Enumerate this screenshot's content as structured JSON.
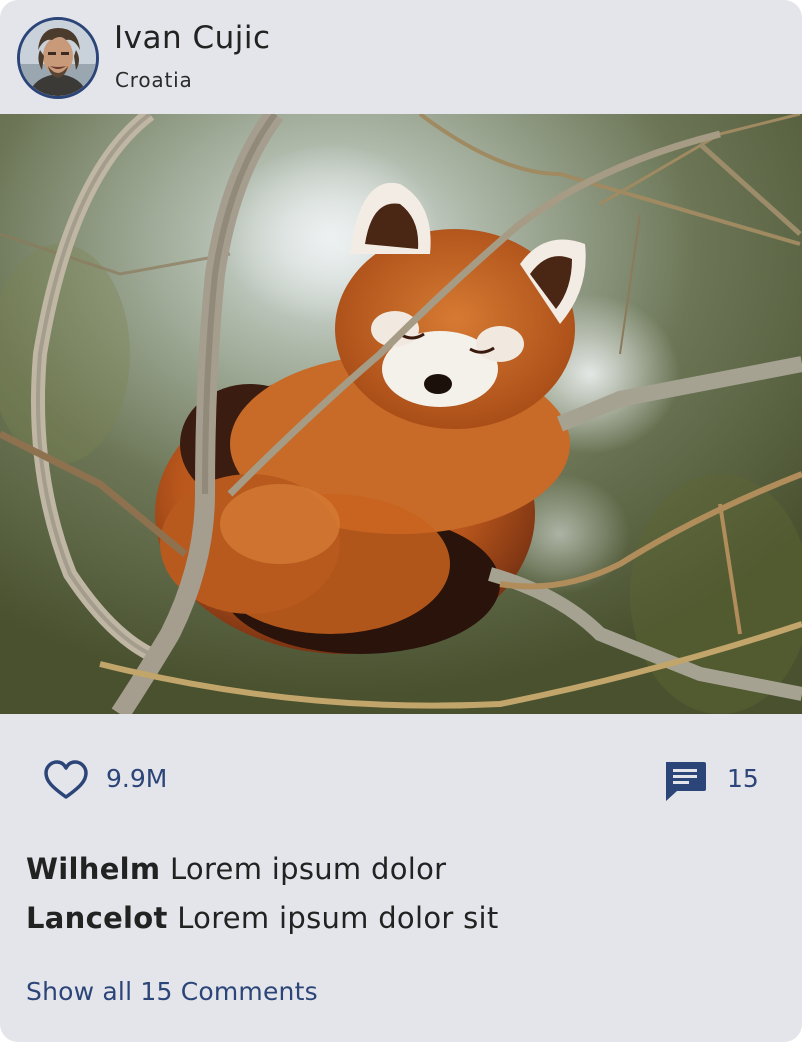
{
  "post": {
    "author": {
      "name": "Ivan Cujic",
      "location": "Croatia"
    },
    "image": {
      "subject": "red-panda-in-tree"
    },
    "likes": {
      "count": "9.9M",
      "icon": "heart-icon"
    },
    "comments": {
      "count": "15",
      "icon": "comment-icon",
      "items": [
        {
          "user": "Wilhelm",
          "text": "Lorem ipsum dolor"
        },
        {
          "user": "Lancelot",
          "text": "Lorem ipsum dolor sit"
        }
      ],
      "show_all_label": "Show all 15 Comments"
    }
  },
  "colors": {
    "card_bg": "#e4e5ea",
    "accent": "#2c4579",
    "text": "#222222"
  }
}
